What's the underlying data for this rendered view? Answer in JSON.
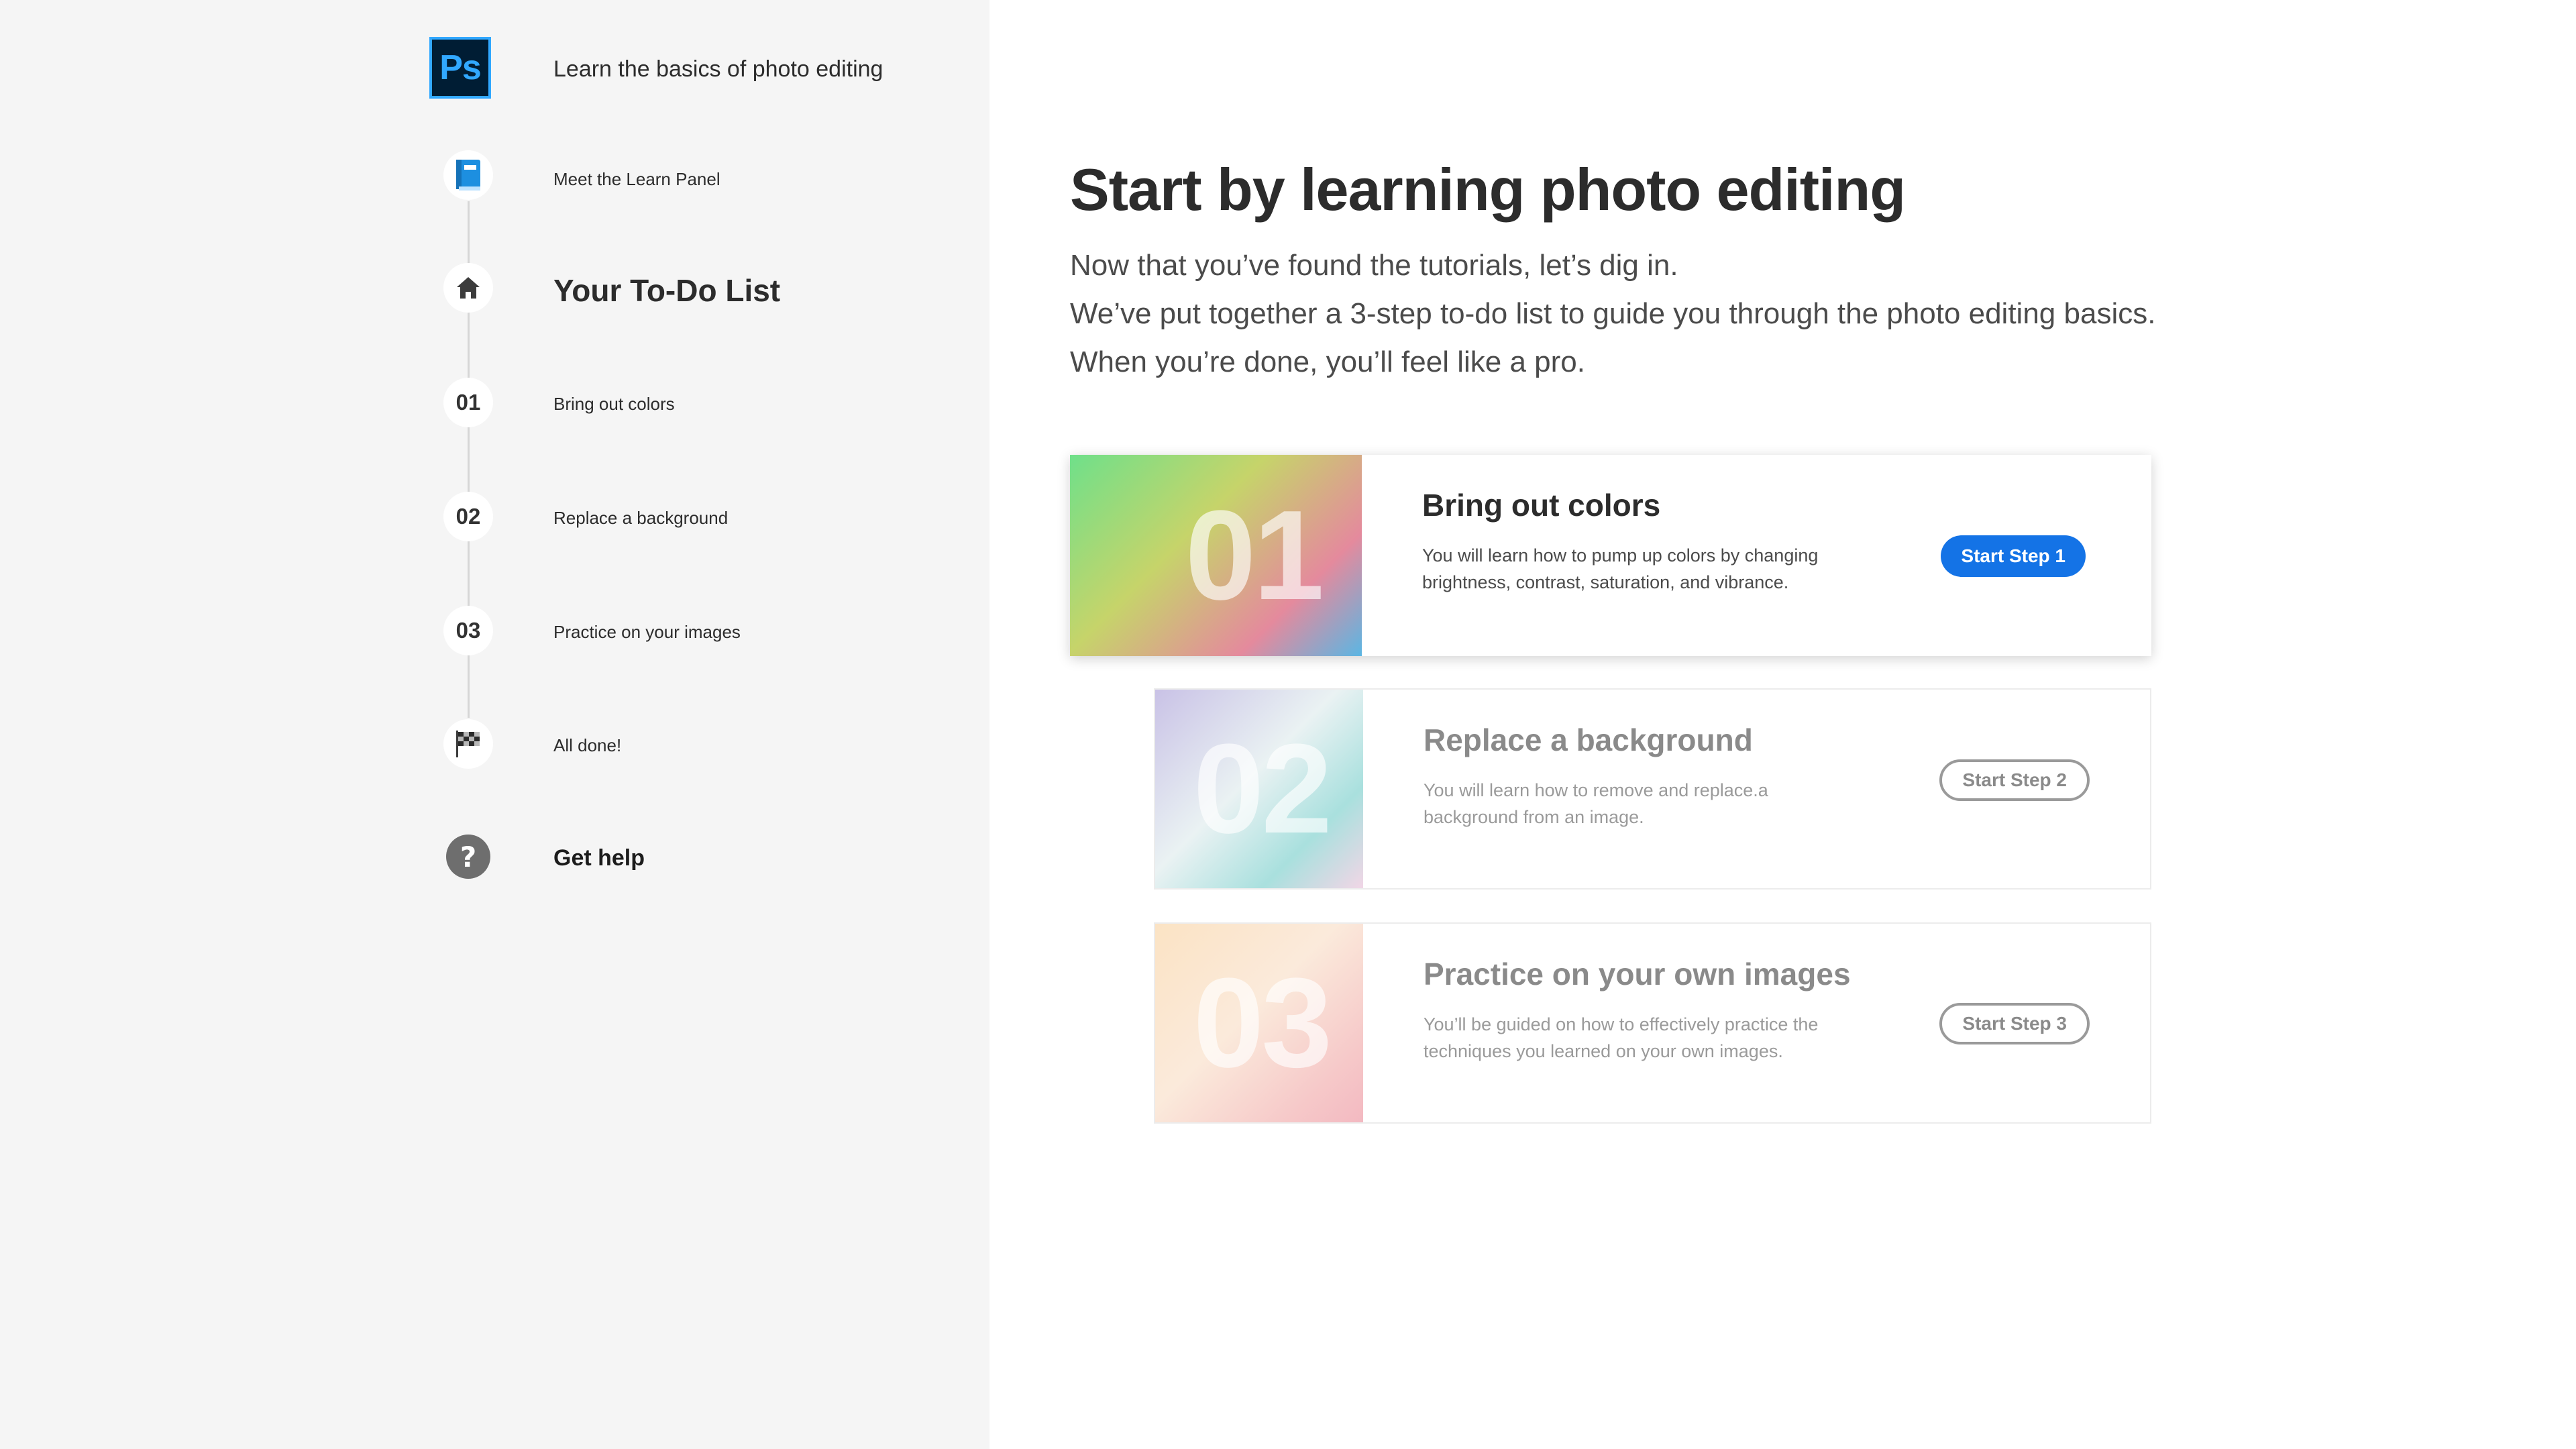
{
  "app": {
    "logo_text": "Ps",
    "course_title": "Learn the basics of photo editing"
  },
  "sidebar": {
    "items": [
      {
        "icon": "book-icon",
        "label": "Meet the Learn Panel"
      },
      {
        "icon": "home-icon",
        "label": "Your To-Do List"
      },
      {
        "icon_text": "01",
        "label": "Bring out colors"
      },
      {
        "icon_text": "02",
        "label": "Replace a background"
      },
      {
        "icon_text": "03",
        "label": "Practice on your images"
      },
      {
        "icon": "checkered-flag-icon",
        "label": "All done!"
      }
    ],
    "help": {
      "icon": "help-icon",
      "label": "Get help"
    }
  },
  "main": {
    "title": "Start by learning photo editing",
    "intro_lines": [
      "Now that you’ve found the tutorials, let’s dig in.",
      "We’ve put together a 3-step to-do list to guide you through the photo editing basics.",
      "When you’re done, you’ll feel like a pro."
    ],
    "steps": [
      {
        "number": "01",
        "title": "Bring out colors",
        "description": "You will learn how to pump up colors by changing brightness, contrast, saturation, and vibrance.",
        "button": "Start Step 1",
        "state": "active"
      },
      {
        "number": "02",
        "title": "Replace a background",
        "description": "You will learn how to remove and replace.a background from an image.",
        "button": "Start Step 2",
        "state": "inactive"
      },
      {
        "number": "03",
        "title": "Practice on your own images",
        "description": "You’ll be guided on how to effectively practice the techniques you learned on your own images.",
        "button": "Start Step 3",
        "state": "inactive"
      }
    ]
  },
  "colors": {
    "accent": "#1473e6",
    "ps_blue": "#31a8ff",
    "ps_dark": "#001d34",
    "sidebar_bg": "#f5f5f5"
  }
}
